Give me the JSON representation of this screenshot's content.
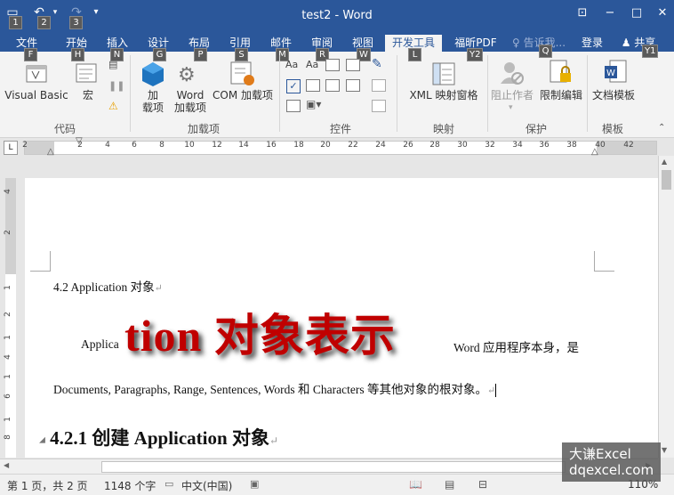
{
  "window": {
    "title": "test2 - Word"
  },
  "quick_access": {
    "keytips": [
      "1",
      "2",
      "3"
    ]
  },
  "tabs": [
    {
      "label": "文件",
      "keytip": "F"
    },
    {
      "label": "开始",
      "keytip": "H"
    },
    {
      "label": "插入",
      "keytip": "N"
    },
    {
      "label": "设计",
      "keytip": "G"
    },
    {
      "label": "布局",
      "keytip": "P"
    },
    {
      "label": "引用",
      "keytip": "S"
    },
    {
      "label": "邮件",
      "keytip": "M"
    },
    {
      "label": "审阅",
      "keytip": "R"
    },
    {
      "label": "视图",
      "keytip": "W"
    },
    {
      "label": "开发工具",
      "keytip": "L"
    },
    {
      "label": "福昕PDF",
      "keytip": "Y2"
    },
    {
      "label": "告诉我...",
      "keytip": "Q"
    },
    {
      "label": "登录",
      "keytip": ""
    },
    {
      "label": "共享",
      "keytip": "Y1"
    }
  ],
  "ribbon": {
    "code": {
      "group": "代码",
      "visual_basic": "Visual Basic",
      "macro": "宏"
    },
    "addins": {
      "group": "加载项",
      "addins_l1": "加",
      "addins_l2": "载项",
      "word_l1": "Word",
      "word_l2": "加载项",
      "com": "COM 加载项"
    },
    "controls": {
      "group": "控件"
    },
    "mapping": {
      "group": "映射",
      "xml": "XML 映射窗格"
    },
    "protect": {
      "group": "保护",
      "block_authors": "阻止作者",
      "restrict": "限制编辑"
    },
    "templates": {
      "group": "模板",
      "doc_template": "文档模板"
    }
  },
  "ruler": {
    "ticks": [
      "2",
      "2",
      "4",
      "6",
      "8",
      "10",
      "12",
      "14",
      "16",
      "18",
      "20",
      "22",
      "24",
      "26",
      "28",
      "30",
      "32",
      "34",
      "36",
      "38",
      "40",
      "42"
    ]
  },
  "vruler": {
    "ticks": [
      "4",
      "2",
      "1",
      "2",
      "1",
      "4",
      "1",
      "6",
      "1",
      "8"
    ]
  },
  "document": {
    "heading1": "4.2 Application  对象",
    "para_prefix": "Applica",
    "para_suffix": "Word 应用程序本身，是",
    "para_line2": "Documents, Paragraphs, Range, Sentences, Words 和 Characters 等其他对象的根对象。",
    "heading2_num": "4.2.1",
    "heading2_text": "创建 Application 对象",
    "overlay": "tion  对象表示"
  },
  "status": {
    "page": "第 1 页，共 2 页",
    "words": "1148 个字",
    "lang": "中文(中国)",
    "zoom": "110%"
  },
  "watermark": {
    "line1": "大谦Excel",
    "line2": "dqexcel.com"
  },
  "colors": {
    "brand": "#2b579a",
    "overlay": "#c00000"
  }
}
